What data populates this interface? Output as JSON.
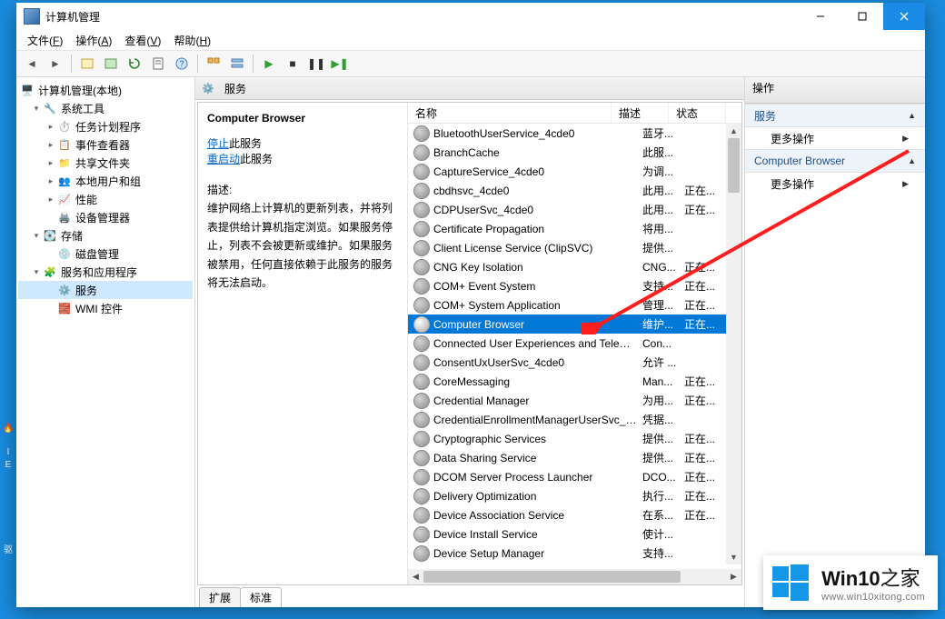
{
  "window": {
    "title": "计算机管理"
  },
  "menu": [
    {
      "label": "文件",
      "key": "F"
    },
    {
      "label": "操作",
      "key": "A"
    },
    {
      "label": "查看",
      "key": "V"
    },
    {
      "label": "帮助",
      "key": "H"
    }
  ],
  "tree": {
    "root": "计算机管理(本地)",
    "groups": [
      {
        "label": "系统工具",
        "children": [
          {
            "label": "任务计划程序"
          },
          {
            "label": "事件查看器"
          },
          {
            "label": "共享文件夹"
          },
          {
            "label": "本地用户和组"
          },
          {
            "label": "性能"
          },
          {
            "label": "设备管理器"
          }
        ]
      },
      {
        "label": "存储",
        "children": [
          {
            "label": "磁盘管理"
          }
        ]
      },
      {
        "label": "服务和应用程序",
        "children": [
          {
            "label": "服务",
            "selected": true
          },
          {
            "label": "WMI 控件"
          }
        ]
      }
    ]
  },
  "center_header": "服务",
  "detail": {
    "title": "Computer Browser",
    "stop_link": "停止",
    "stop_suffix": "此服务",
    "restart_link": "重启动",
    "restart_suffix": "此服务",
    "desc_label": "描述:",
    "desc_text": "维护网络上计算机的更新列表，并将列表提供给计算机指定浏览。如果服务停止，列表不会被更新或维护。如果服务被禁用，任何直接依赖于此服务的服务将无法启动。"
  },
  "columns": {
    "name": "名称",
    "desc": "描述",
    "state": "状态"
  },
  "services": [
    {
      "name": "BluetoothUserService_4cde0",
      "desc": "蓝牙...",
      "state": ""
    },
    {
      "name": "BranchCache",
      "desc": "此服...",
      "state": ""
    },
    {
      "name": "CaptureService_4cde0",
      "desc": "为调...",
      "state": ""
    },
    {
      "name": "cbdhsvc_4cde0",
      "desc": "此用...",
      "state": "正在..."
    },
    {
      "name": "CDPUserSvc_4cde0",
      "desc": "此用...",
      "state": "正在..."
    },
    {
      "name": "Certificate Propagation",
      "desc": "将用...",
      "state": ""
    },
    {
      "name": "Client License Service (ClipSVC)",
      "desc": "提供...",
      "state": ""
    },
    {
      "name": "CNG Key Isolation",
      "desc": "CNG...",
      "state": "正在..."
    },
    {
      "name": "COM+ Event System",
      "desc": "支持...",
      "state": "正在..."
    },
    {
      "name": "COM+ System Application",
      "desc": "管理...",
      "state": "正在..."
    },
    {
      "name": "Computer Browser",
      "desc": "维护...",
      "state": "正在...",
      "selected": true
    },
    {
      "name": "Connected User Experiences and Teleme...",
      "desc": "Con...",
      "state": ""
    },
    {
      "name": "ConsentUxUserSvc_4cde0",
      "desc": "允许 ...",
      "state": ""
    },
    {
      "name": "CoreMessaging",
      "desc": "Man...",
      "state": "正在..."
    },
    {
      "name": "Credential Manager",
      "desc": "为用...",
      "state": "正在..."
    },
    {
      "name": "CredentialEnrollmentManagerUserSvc_4c...",
      "desc": "凭据...",
      "state": ""
    },
    {
      "name": "Cryptographic Services",
      "desc": "提供...",
      "state": "正在..."
    },
    {
      "name": "Data Sharing Service",
      "desc": "提供...",
      "state": "正在..."
    },
    {
      "name": "DCOM Server Process Launcher",
      "desc": "DCO...",
      "state": "正在..."
    },
    {
      "name": "Delivery Optimization",
      "desc": "执行...",
      "state": "正在..."
    },
    {
      "name": "Device Association Service",
      "desc": "在系...",
      "state": "正在..."
    },
    {
      "name": "Device Install Service",
      "desc": "使计...",
      "state": ""
    },
    {
      "name": "Device Setup Manager",
      "desc": "支持...",
      "state": ""
    }
  ],
  "tabs": {
    "extended": "扩展",
    "standard": "标准"
  },
  "actions": {
    "header": "操作",
    "cat1": "服务",
    "more": "更多操作",
    "cat2": "Computer Browser"
  },
  "watermark": {
    "big": "Win10",
    "suffix": "之家",
    "url": "www.win10xitong.com"
  },
  "desktop_label_1": "I",
  "desktop_label_2": "E",
  "desktop_label_3": "驱"
}
